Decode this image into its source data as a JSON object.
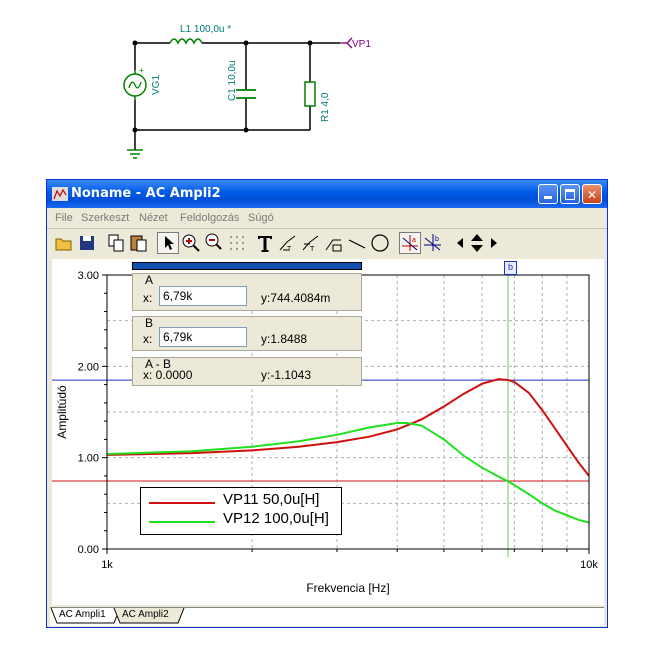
{
  "schematic": {
    "inductor_label": "L1 100,0u *",
    "capacitor_label": "C1 10,0u",
    "resistor_label": "R1 4,0",
    "source_label": "VG1",
    "probe_label": "VP1",
    "colors": {
      "wire": "#000000",
      "component": "#008000",
      "label": "#007a7a",
      "probe": "#800080"
    }
  },
  "window": {
    "title": "Noname - AC Ampli2",
    "buttons": [
      "minimize",
      "maximize",
      "close"
    ]
  },
  "menu": [
    "File",
    "Szerkeszt",
    "Nézet",
    "Feldolgozás",
    "Súgó"
  ],
  "toolbar": {
    "icons": [
      "open-icon",
      "save-icon",
      "copy-icon",
      "paste-icon",
      "pointer-icon",
      "zoom-in-icon",
      "zoom-100-icon",
      "grid-icon",
      "text-icon",
      "curve-text-icon",
      "curve-text2-icon",
      "curve-text3-icon",
      "line-icon",
      "ellipse-icon",
      "cursor-a-icon",
      "cursor-b-icon",
      "arrow-left-icon",
      "arrow-updown-icon",
      "arrow-right-icon"
    ]
  },
  "cursors": {
    "a": {
      "caption": "A",
      "x_label": "x:",
      "x_value": "6,79k",
      "y_text": "y:744.4084m"
    },
    "b": {
      "caption": "B",
      "x_label": "x:",
      "x_value": "6,79k",
      "y_text": "y:1.8488"
    },
    "diff": {
      "caption": "A - B",
      "x_text": "x: 0.0000",
      "y_text": "y:-1.1043"
    },
    "b_marker": "b"
  },
  "tabs": [
    "AC Ampli1",
    "AC Ampli2"
  ],
  "chart_data": {
    "type": "line",
    "title": "",
    "xlabel": "Frekvencia [Hz]",
    "ylabel": "Amplitúdó",
    "xscale": "log",
    "xlim": [
      1000,
      10000
    ],
    "ylim": [
      0,
      3
    ],
    "x_tick_labels": [
      "1k",
      "10k"
    ],
    "y_tick_labels": [
      "0.00",
      "1.00",
      "2.00",
      "3.00"
    ],
    "grid": true,
    "legend_position": "bottom-left",
    "series": [
      {
        "name": "VP11  50,0u[H]",
        "color": "#d01010",
        "x": [
          1000,
          1500,
          2000,
          2500,
          3000,
          3500,
          4000,
          4500,
          5000,
          5500,
          6000,
          6500,
          6790,
          7000,
          7500,
          8000,
          8500,
          9000,
          9500,
          10000
        ],
        "y": [
          1.03,
          1.05,
          1.08,
          1.12,
          1.17,
          1.23,
          1.31,
          1.42,
          1.56,
          1.7,
          1.81,
          1.86,
          1.85,
          1.83,
          1.71,
          1.52,
          1.32,
          1.13,
          0.95,
          0.8
        ]
      },
      {
        "name": "VP12  100,0u[H]",
        "color": "#20e020",
        "x": [
          1000,
          1500,
          2000,
          2500,
          3000,
          3500,
          4000,
          4200,
          4500,
          5000,
          5500,
          6000,
          6500,
          6790,
          7000,
          7500,
          8000,
          8500,
          9000,
          9500,
          10000
        ],
        "y": [
          1.04,
          1.07,
          1.12,
          1.18,
          1.25,
          1.33,
          1.38,
          1.38,
          1.35,
          1.2,
          1.02,
          0.89,
          0.79,
          0.74,
          0.7,
          0.6,
          0.5,
          0.42,
          0.37,
          0.32,
          0.29
        ]
      }
    ],
    "cursor_lines": {
      "a_y": 0.7444,
      "b_y": 1.8488,
      "x": 6790,
      "colors": {
        "a": "#d01010",
        "b": "#2030c0",
        "x": "#60d060"
      }
    }
  }
}
